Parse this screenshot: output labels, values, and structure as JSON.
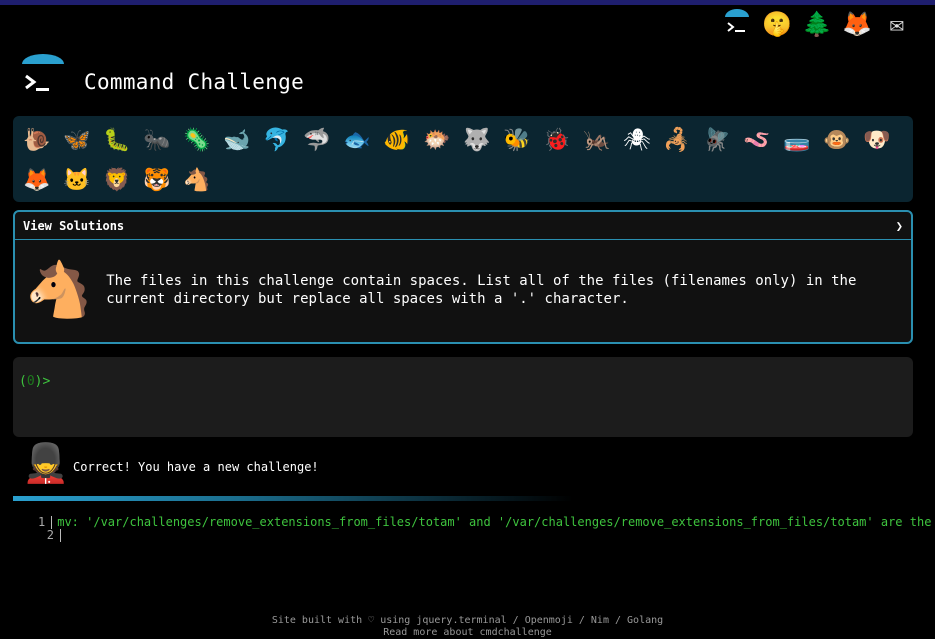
{
  "app": {
    "title": "Command Challenge"
  },
  "top_icons": [
    {
      "name": "terminal-logo-icon",
      "glyph": ""
    },
    {
      "name": "surprised-face-icon",
      "glyph": "🤫"
    },
    {
      "name": "christmas-tree-icon",
      "glyph": "🌲"
    },
    {
      "name": "gitlab-fox-icon",
      "glyph": "🦊"
    },
    {
      "name": "mail-envelope-icon",
      "glyph": "✉"
    }
  ],
  "challenges": [
    {
      "name": "snail-icon",
      "glyph": "🐌"
    },
    {
      "name": "butterfly-icon",
      "glyph": "🦋"
    },
    {
      "name": "caterpillar-icon",
      "glyph": "🐛"
    },
    {
      "name": "ant-icon",
      "glyph": "🐜"
    },
    {
      "name": "microbe-icon",
      "glyph": "🦠"
    },
    {
      "name": "whale-icon",
      "glyph": "🐋"
    },
    {
      "name": "dolphin-icon",
      "glyph": "🐬"
    },
    {
      "name": "shark-icon",
      "glyph": "🦈"
    },
    {
      "name": "fish-icon",
      "glyph": "🐟"
    },
    {
      "name": "tropical-fish-icon",
      "glyph": "🐠"
    },
    {
      "name": "blowfish-icon",
      "glyph": "🐡"
    },
    {
      "name": "wolf-icon",
      "glyph": "🐺"
    },
    {
      "name": "bee-icon",
      "glyph": "🐝"
    },
    {
      "name": "ladybug-icon",
      "glyph": "🐞"
    },
    {
      "name": "cricket-icon",
      "glyph": "🦗"
    },
    {
      "name": "spider-icon",
      "glyph": "🕷"
    },
    {
      "name": "scorpion-icon",
      "glyph": "🦂"
    },
    {
      "name": "fly-icon",
      "glyph": "🪰"
    },
    {
      "name": "worm-icon",
      "glyph": "🪱"
    },
    {
      "name": "bacteria-icon",
      "glyph": "🧫"
    },
    {
      "name": "monkey-icon",
      "glyph": "🐵"
    },
    {
      "name": "dog-icon",
      "glyph": "🐶"
    },
    {
      "name": "fox-icon",
      "glyph": "🦊"
    },
    {
      "name": "cat-icon",
      "glyph": "🐱"
    },
    {
      "name": "lion-icon",
      "glyph": "🦁"
    },
    {
      "name": "tiger-icon",
      "glyph": "🐯"
    },
    {
      "name": "horse-icon",
      "glyph": "🐴"
    }
  ],
  "solution": {
    "header_label": "View Solutions",
    "toggle_glyph": "❯",
    "horse_glyph": "🐴",
    "text": "The files in this challenge contain spaces. List all of the files (filenames only) in the current directory but replace all spaces with a '.' character."
  },
  "terminal": {
    "prompt_open": "(",
    "prompt_count": "0",
    "prompt_close": ")>"
  },
  "guard": {
    "glyph": "💂",
    "message": "Correct! You have a new challenge!"
  },
  "output": {
    "lines": [
      {
        "num": "1",
        "text": "mv: '/var/challenges/remove_extensions_from_files/totam' and '/var/challenges/remove_extensions_from_files/totam' are the same file"
      },
      {
        "num": "2",
        "text": ""
      }
    ]
  },
  "footer": {
    "line1": "Site built with ♡ using jquery.terminal / Openmoji / Nim / Golang",
    "line2": "Read more about cmdchallenge"
  },
  "colors": {
    "accent": "#2a8fb0",
    "prompt_green": "#3ec33e",
    "panel": "#0b2530"
  }
}
